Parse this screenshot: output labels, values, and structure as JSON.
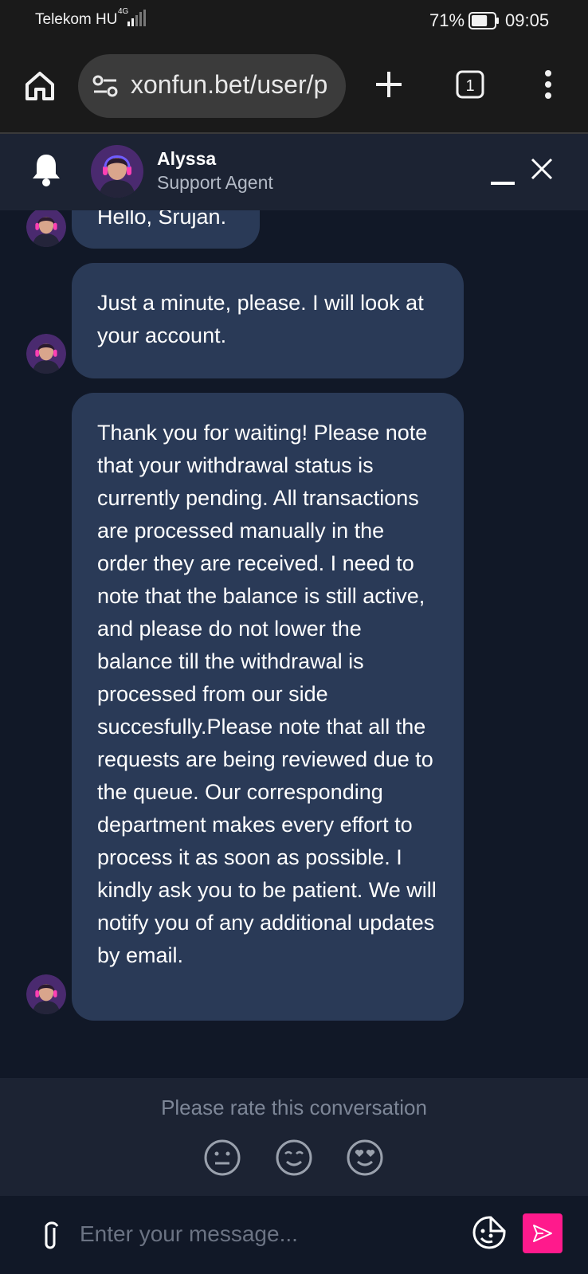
{
  "status_bar": {
    "carrier": "Telekom HU",
    "network": "4G",
    "battery_percent": "71%",
    "battery_level": 0.71,
    "time": "09:05"
  },
  "browser": {
    "url": "xonfun.bet/user/p",
    "tab_count": "1",
    "icons": [
      "home-icon",
      "site-settings-icon",
      "plus-icon",
      "tabs-icon",
      "more-vert-icon"
    ]
  },
  "chat": {
    "agent_name": "Alyssa",
    "agent_role": "Support Agent",
    "messages": [
      {
        "from": "agent",
        "text": "Hello, Srujan."
      },
      {
        "from": "agent",
        "text": "Just a minute, please. I will look at your account."
      },
      {
        "from": "agent",
        "text": "Thank you for waiting! Please note that your withdrawal status is currently pending. All transactions are processed manually in the order they are received. I need to note that the balance is still active, and please do not lower the balance till the withdrawal is processed from our side succesfully.Please note that all the requests are being reviewed due to the queue. Our corresponding department makes every effort to process it as soon as possible. I kindly ask you to be patient. We will notify you of any additional updates by email."
      }
    ]
  },
  "rating": {
    "prompt": "Please rate this conversation",
    "options": [
      "neutral-face-icon",
      "smiling-face-icon",
      "heart-eyes-face-icon"
    ]
  },
  "composer": {
    "placeholder": "Enter your message..."
  },
  "colors": {
    "background": "#111827",
    "header": "#1c2333",
    "bubble": "#2a3a57",
    "send_accent": "#ff1a8c"
  }
}
